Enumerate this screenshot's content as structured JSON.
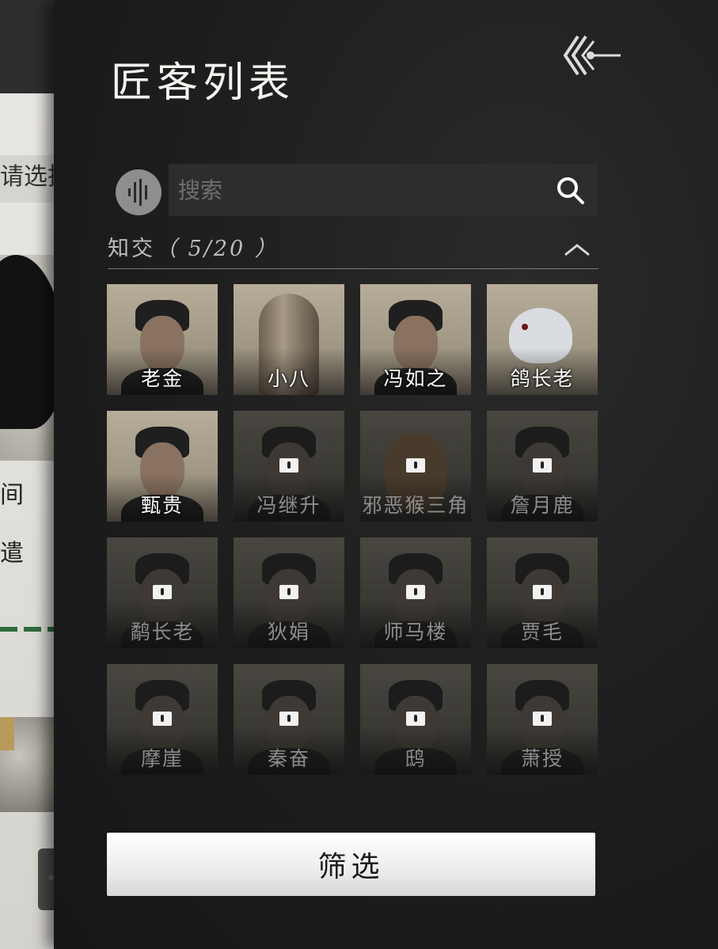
{
  "background": {
    "hint_text": "请选择",
    "label_a": "间",
    "label_b": "遣"
  },
  "panel": {
    "title": "匠客列表",
    "search": {
      "placeholder": "搜索",
      "value": ""
    },
    "section": {
      "name": "知交",
      "count_text": "（ 5/20 ）"
    },
    "filter_label": "筛选"
  },
  "characters": [
    {
      "name": "老金",
      "locked": false
    },
    {
      "name": "小八",
      "locked": false
    },
    {
      "name": "冯如之",
      "locked": false
    },
    {
      "name": "鸽长老",
      "locked": false
    },
    {
      "name": "甄贵",
      "locked": false
    },
    {
      "name": "冯继升",
      "locked": true
    },
    {
      "name": "邪恶猴三角",
      "locked": true
    },
    {
      "name": "詹月鹿",
      "locked": true
    },
    {
      "name": "鹬长老",
      "locked": true
    },
    {
      "name": "狄娟",
      "locked": true
    },
    {
      "name": "师马楼",
      "locked": true
    },
    {
      "name": "贾毛",
      "locked": true
    },
    {
      "name": "摩崖",
      "locked": true
    },
    {
      "name": "秦奋",
      "locked": true
    },
    {
      "name": "鸱",
      "locked": true
    },
    {
      "name": "萧授",
      "locked": true
    }
  ],
  "colors": {
    "panel_bg": "#1d1d1d",
    "title": "#f4f2ee",
    "search_bg": "#2d2d2d",
    "locked_text": "#8c8c8c",
    "unlocked_text": "#ffffff",
    "button_bg": "#ececec"
  }
}
